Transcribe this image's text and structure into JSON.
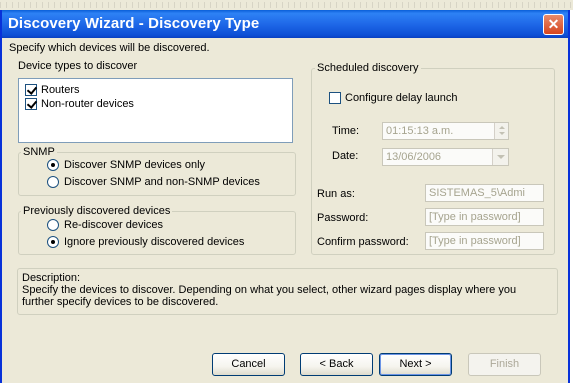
{
  "window": {
    "title": "Discovery Wizard - Discovery Type",
    "close_glyph": "✕"
  },
  "intro": "Specify which devices will be discovered.",
  "device_types": {
    "label": "Device types to discover",
    "items": [
      {
        "label": "Routers",
        "checked": true
      },
      {
        "label": "Non-router devices",
        "checked": true
      }
    ]
  },
  "snmp": {
    "legend": "SNMP",
    "options": [
      {
        "label": "Discover SNMP devices only",
        "selected": true
      },
      {
        "label": "Discover SNMP and non-SNMP devices",
        "selected": false
      }
    ]
  },
  "previously": {
    "legend": "Previously discovered devices",
    "options": [
      {
        "label": "Re-discover devices",
        "selected": false
      },
      {
        "label": "Ignore previously discovered devices",
        "selected": true
      }
    ]
  },
  "scheduled": {
    "legend": "Scheduled discovery",
    "configure_label": "Configure delay launch",
    "time_label": "Time:",
    "time_value": "01:15:13 a.m.",
    "date_label": "Date:",
    "date_value": "13/06/2006",
    "run_as_label": "Run as:",
    "run_as_value": "SISTEMAS_5\\Admi",
    "password_label": "Password:",
    "password_placeholder": "[Type in password]",
    "confirm_label": "Confirm password:",
    "confirm_placeholder": "[Type in password]"
  },
  "description": {
    "legend": "Description:",
    "text": "Specify the devices to discover. Depending on what you select, other wizard pages display where you further specify devices to be discovered."
  },
  "buttons": {
    "cancel": "Cancel",
    "back": "< Back",
    "next": "Next >",
    "finish": "Finish"
  },
  "colors": {
    "titlebar": "#1f68e8",
    "dialog_bg": "#ece9d8",
    "close_button": "#d6451f"
  }
}
